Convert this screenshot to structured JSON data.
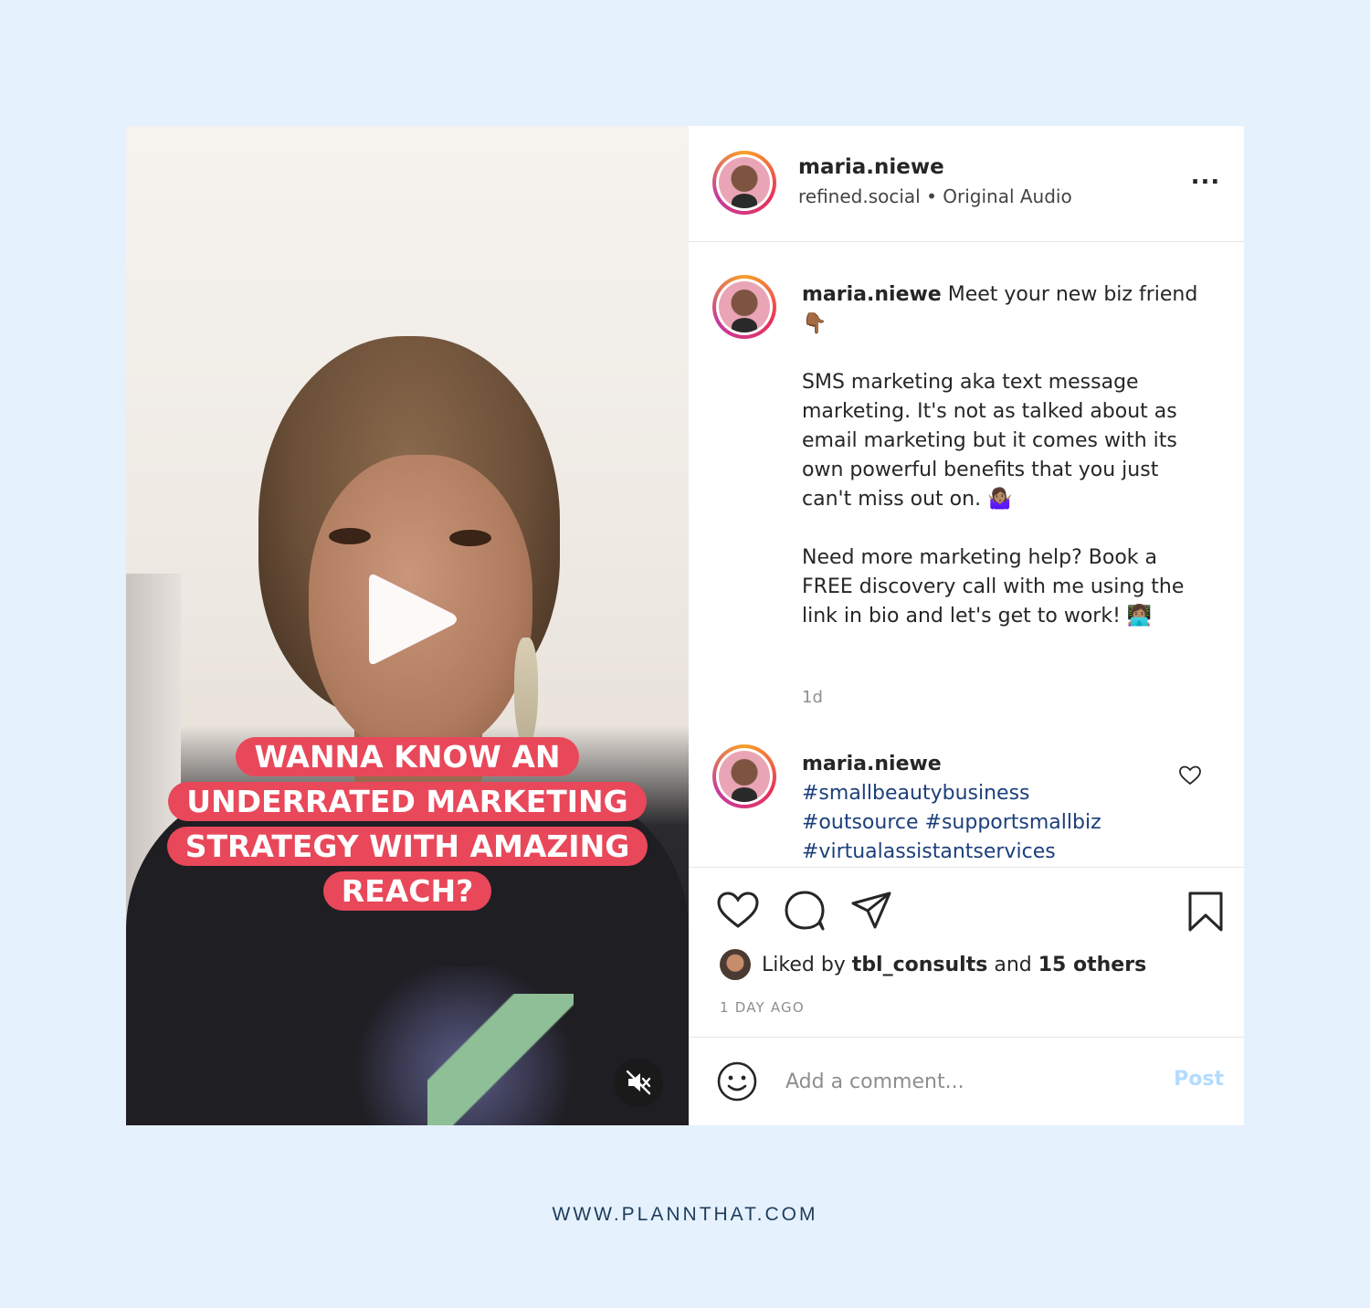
{
  "media": {
    "overlay_lines": [
      "WANNA KNOW AN",
      "UNDERRATED MARKETING",
      "STRATEGY WITH AMAZING",
      "REACH?"
    ],
    "play_icon": "play-icon",
    "mute_icon": "muted-speaker-icon"
  },
  "header": {
    "username": "maria.niewe",
    "subtitle": "refined.social • Original Audio",
    "more_label": "..."
  },
  "caption": {
    "username": "maria.niewe",
    "line1": " Meet your new biz friend 👇🏾",
    "para2": "SMS marketing aka text message marketing. It's not as talked about as email marketing but it comes with its own powerful benefits that you just can't miss out on. 🤷🏽‍♀️",
    "para3": "Need more marketing help? Book a FREE discovery call with me using the link in bio and let's get to work! 👩🏽‍💻",
    "time": "1d"
  },
  "comment": {
    "username": "maria.niewe",
    "hashtags": [
      "#smallbeautybusiness",
      "#outsource #supportsmallbiz",
      "#virtualassistantservices"
    ]
  },
  "actions": {
    "liked_by_prefix": "Liked by ",
    "liked_by_user": "tbl_consults",
    "liked_by_mid": " and ",
    "liked_by_others": "15 others",
    "post_age": "1 DAY AGO"
  },
  "comment_box": {
    "placeholder": "Add a comment...",
    "post_label": "Post"
  },
  "footer": {
    "url": "WWW.PLANNTHAT.COM"
  },
  "colors": {
    "page_bg": "#e5f1fd",
    "overlay_pink": "#e8485a",
    "hashtag_blue": "#1c3f7b",
    "post_button_disabled": "#b3dbff"
  }
}
